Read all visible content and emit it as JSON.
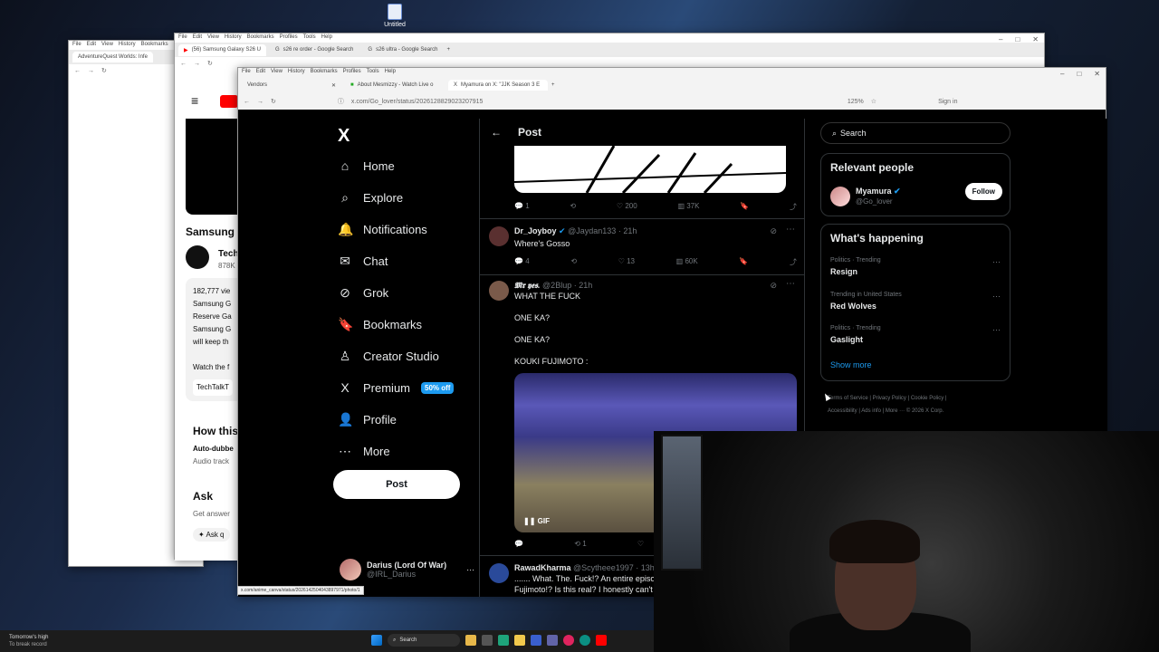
{
  "desktop": {
    "icon_label": "Untitled"
  },
  "left_window": {
    "menu": [
      "File",
      "Edit",
      "View",
      "History",
      "Bookmarks",
      "Pr"
    ],
    "tab_title": "AdventureQuest Worlds: Infe"
  },
  "yt_window": {
    "menu": [
      "File",
      "Edit",
      "View",
      "History",
      "Bookmarks",
      "Profiles",
      "Tools",
      "Help"
    ],
    "tabs": [
      "(56) Samsung Galaxy S26 U",
      "s26 re order - Google Search",
      "s26 ultra - Google Search"
    ],
    "video_title": "Samsung",
    "channel": "Tech",
    "subs": "878K",
    "views": "182,777 vie",
    "desc_lines": [
      "Samsung G",
      "Reserve Ga",
      "Samsung G",
      "will keep th"
    ],
    "watch": "Watch the f",
    "chip": "TechTalkT",
    "how": "How this",
    "auto_dub": "Auto-dubbe",
    "audio": "Audio track",
    "ask": "Ask",
    "get_ans": "Get answer",
    "ask_btn": "Ask q"
  },
  "x_window": {
    "menu": [
      "File",
      "Edit",
      "View",
      "History",
      "Bookmarks",
      "Profiles",
      "Tools",
      "Help"
    ],
    "tabs": [
      "Vendors",
      "About Mesmizzy - Watch Live o",
      "Myamura on X: \"JJK Season 3 E"
    ],
    "url": "x.com/Go_lover/status/2026128829023207915",
    "zoom": "125%",
    "sign_in": "Sign in",
    "status_url": "x.com/anime_canva/status/2026142504043897971/photo/1"
  },
  "nav": {
    "items": [
      {
        "icon": "⌂",
        "label": "Home"
      },
      {
        "icon": "⌕",
        "label": "Explore"
      },
      {
        "icon": "🔔",
        "label": "Notifications"
      },
      {
        "icon": "✉",
        "label": "Chat"
      },
      {
        "icon": "⊘",
        "label": "Grok"
      },
      {
        "icon": "🔖",
        "label": "Bookmarks"
      },
      {
        "icon": "♙",
        "label": "Creator Studio"
      },
      {
        "icon": "X",
        "label": "Premium"
      },
      {
        "icon": "👤",
        "label": "Profile"
      },
      {
        "icon": "⋯",
        "label": "More"
      }
    ],
    "premium_badge": "50% off",
    "post_button": "Post",
    "account_name": "Darius (Lord Of War)",
    "account_handle": "@IRL_Darius"
  },
  "center": {
    "header": "Post",
    "top_actions": {
      "replies": "1",
      "likes": "200",
      "views": "37K"
    },
    "tweets": [
      {
        "name": "Dr_Joyboy",
        "handle": "@Jaydan133",
        "time": "21h",
        "text": [
          "Where's Gosso"
        ],
        "replies": "4",
        "likes": "13",
        "views": "60K"
      },
      {
        "name": "𝕸𝖗 𝖞𝖊𝖘.",
        "handle": "@2Blup",
        "time": "21h",
        "text": [
          "WHAT THE FUCK",
          "ONE KA?",
          "ONE KA?",
          "KOUKI FUJIMOTO :"
        ],
        "gif": "GIF",
        "retweets": "1"
      },
      {
        "name": "RawadKharma",
        "handle": "@Scytheee1997",
        "time": "13h",
        "text": [
          "....... What. The. Fuck!? An entire episo",
          "Fujimoto!? Is this real? I honestly can't"
        ]
      }
    ]
  },
  "right": {
    "search_placeholder": "Search",
    "relevant_title": "Relevant people",
    "person_name": "Myamura",
    "person_handle": "@Go_lover",
    "follow": "Follow",
    "happening_title": "What's happening",
    "trends": [
      {
        "context": "Politics · Trending",
        "name": "Resign"
      },
      {
        "context": "Trending in United States",
        "name": "Red Wolves"
      },
      {
        "context": "Politics · Trending",
        "name": "Gaslight"
      }
    ],
    "show_more": "Show more",
    "footer": [
      "Terms of Service",
      "Privacy Policy",
      "Cookie Policy",
      "Accessibility",
      "Ads info",
      "More ···",
      "© 2026 X Corp."
    ]
  },
  "taskbar": {
    "weather_line1": "Tomorrow's high",
    "weather_line2": "To break record",
    "search": "Search"
  }
}
